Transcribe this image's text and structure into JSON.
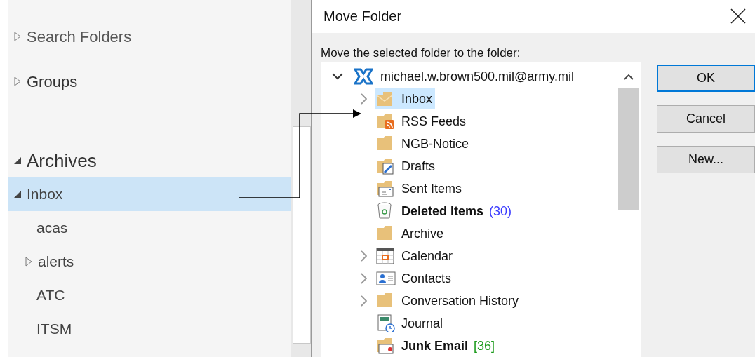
{
  "folder_pane": {
    "items": [
      {
        "kind": "section",
        "label": "Search Folders",
        "expanded": false,
        "selected": false
      },
      {
        "kind": "section",
        "label": "Groups",
        "expanded": false,
        "selected": false
      },
      {
        "kind": "archive",
        "label": "Archives",
        "expanded": true,
        "selected": false,
        "children": [
          {
            "label": "Inbox",
            "expanded": true,
            "selected": true,
            "children": [
              {
                "label": "acas",
                "selected": false
              },
              {
                "label": "alerts",
                "expanded": false,
                "selected": false
              },
              {
                "label": "ATC",
                "selected": false
              },
              {
                "label": "ITSM",
                "selected": false
              }
            ]
          }
        ]
      }
    ]
  },
  "dialog": {
    "title": "Move Folder",
    "prompt": "Move the selected folder to the folder:",
    "tree": {
      "label": "michael.w.brown500.mil@army.mil",
      "expanded": true,
      "selected": false,
      "children": [
        {
          "kind": "inbox",
          "label": "Inbox",
          "expanded": false,
          "selected": true
        },
        {
          "kind": "rss",
          "label": "RSS Feeds",
          "selected": false
        },
        {
          "kind": "folder",
          "label": "NGB-Notice",
          "selected": false
        },
        {
          "kind": "drafts",
          "label": "Drafts",
          "selected": false
        },
        {
          "kind": "sent",
          "label": "Sent Items",
          "selected": false
        },
        {
          "kind": "deleted",
          "label": "Deleted Items",
          "count": "(30)",
          "color": "#3b3bff",
          "selected": false
        },
        {
          "kind": "folder",
          "label": "Archive",
          "selected": false
        },
        {
          "kind": "calendar",
          "label": "Calendar",
          "expanded": false,
          "selected": false
        },
        {
          "kind": "contacts",
          "label": "Contacts",
          "expanded": false,
          "selected": false
        },
        {
          "kind": "folder",
          "label": "Conversation History",
          "expanded": false,
          "selected": false
        },
        {
          "kind": "journal",
          "label": "Journal",
          "selected": false
        },
        {
          "kind": "junk",
          "label": "Junk Email",
          "count": "[36]",
          "color": "#1a9a1a",
          "selected": false
        }
      ]
    },
    "buttons": [
      {
        "label": "OK",
        "default": true
      },
      {
        "label": "Cancel",
        "default": false
      },
      {
        "label": "New...",
        "default": false
      }
    ]
  }
}
